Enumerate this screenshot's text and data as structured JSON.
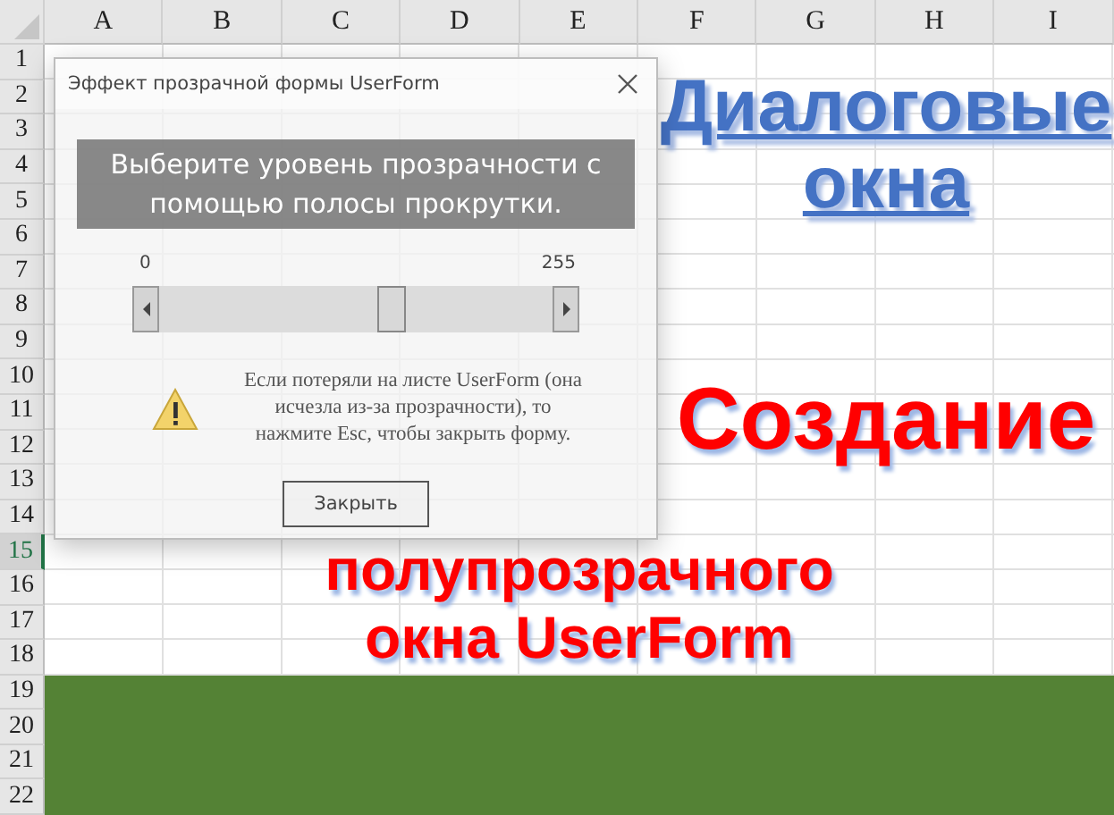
{
  "sheet": {
    "columns": [
      "A",
      "B",
      "C",
      "D",
      "E",
      "F",
      "G",
      "H",
      "I"
    ],
    "rows": [
      {
        "label": "1",
        "selected": false,
        "filled": false
      },
      {
        "label": "2",
        "selected": false,
        "filled": false
      },
      {
        "label": "3",
        "selected": false,
        "filled": false
      },
      {
        "label": "4",
        "selected": false,
        "filled": false
      },
      {
        "label": "5",
        "selected": false,
        "filled": false
      },
      {
        "label": "6",
        "selected": false,
        "filled": false
      },
      {
        "label": "7",
        "selected": false,
        "filled": false
      },
      {
        "label": "8",
        "selected": false,
        "filled": false
      },
      {
        "label": "9",
        "selected": false,
        "filled": false
      },
      {
        "label": "10",
        "selected": false,
        "filled": false
      },
      {
        "label": "11",
        "selected": false,
        "filled": false
      },
      {
        "label": "12",
        "selected": false,
        "filled": false
      },
      {
        "label": "13",
        "selected": false,
        "filled": false
      },
      {
        "label": "14",
        "selected": false,
        "filled": false
      },
      {
        "label": "15",
        "selected": true,
        "filled": false
      },
      {
        "label": "16",
        "selected": false,
        "filled": false
      },
      {
        "label": "17",
        "selected": false,
        "filled": false
      },
      {
        "label": "18",
        "selected": false,
        "filled": false
      },
      {
        "label": "19",
        "selected": false,
        "filled": true
      },
      {
        "label": "20",
        "selected": false,
        "filled": true
      },
      {
        "label": "21",
        "selected": false,
        "filled": true
      },
      {
        "label": "22",
        "selected": false,
        "filled": true
      }
    ]
  },
  "wordart": [
    {
      "kind": "heading",
      "lines": [
        "Диалоговые",
        "окна"
      ]
    },
    {
      "kind": "title",
      "lines": [
        "Создание",
        "полупрозрачного",
        "окна UserForm"
      ]
    }
  ],
  "dialog": {
    "title": "Эффект прозрачной формы UserForm",
    "prompt": "Выберите уровень прозрачности с помощью полосы прокрутки.",
    "scroll_min": "0",
    "scroll_max": "255",
    "scrollbar": {
      "level": 0.6
    },
    "warning": "Если потеряли на листе UserForm (она исчезла из-за прозрачности), то нажмите Esc, чтобы закрыть форму.",
    "button": "Закрыть"
  }
}
